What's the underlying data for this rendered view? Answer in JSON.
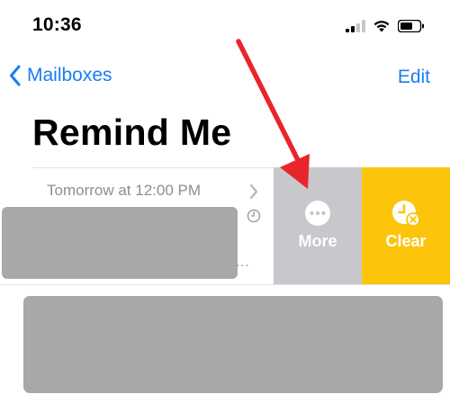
{
  "status_bar": {
    "time": "10:36",
    "icons": [
      "cellular-signal-icon",
      "wifi-icon",
      "battery-icon"
    ]
  },
  "nav": {
    "back_label": "Mailboxes",
    "edit_label": "Edit",
    "accent_color": "#1a7cf4"
  },
  "page": {
    "title": "Remind Me"
  },
  "message_row": {
    "date_text": "Tomorrow at 12:00 PM",
    "icons": [
      "chevron-right-icon",
      "clock-icon"
    ],
    "preview_truncation": "..."
  },
  "swipe_actions": [
    {
      "label": "More",
      "icon": "ellipsis-circle-icon",
      "color": "#c8c7cc"
    },
    {
      "label": "Clear",
      "icon": "clock-x-icon",
      "color": "#fcc40b"
    }
  ],
  "annotation": {
    "type": "arrow",
    "color": "#e8252d",
    "points_to": "More"
  }
}
